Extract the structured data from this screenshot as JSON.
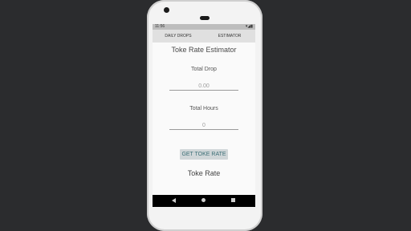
{
  "status_bar": {
    "time": "11:56",
    "right": "▾◢▮"
  },
  "tabs": [
    {
      "label": "DAILY DROPS"
    },
    {
      "label": "ESTIMATOR"
    }
  ],
  "screen": {
    "title": "Toke Rate Estimator",
    "total_drop_label": "Total Drop",
    "total_drop_value": "0.00",
    "total_hours_label": "Total Hours",
    "total_hours_value": "0",
    "button_label": "GET TOKE RATE",
    "result_label": "Toke Rate"
  },
  "icons": {
    "nav_back": "back-triangle-icon",
    "nav_home": "home-circle-icon",
    "nav_recent": "recent-square-icon"
  }
}
